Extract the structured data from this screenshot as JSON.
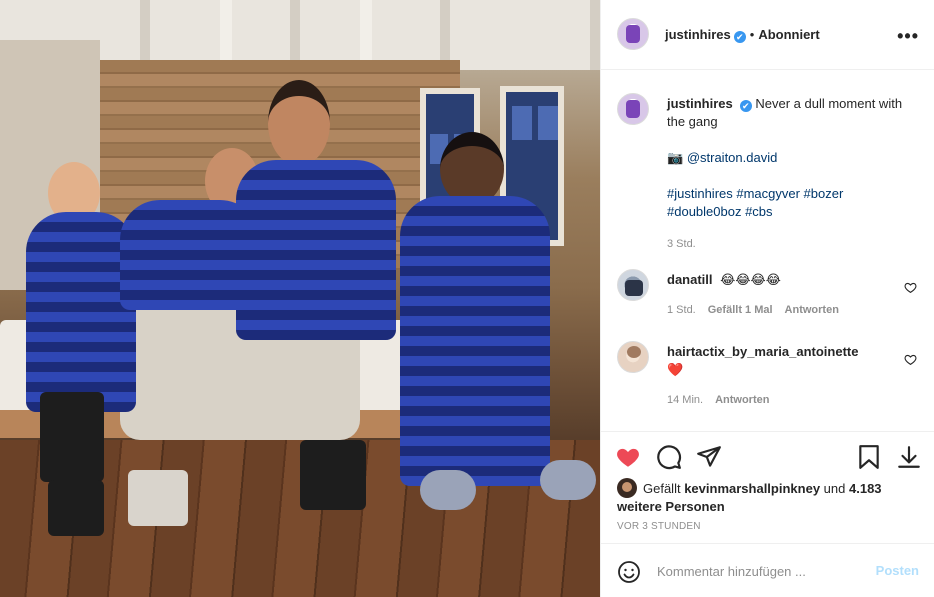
{
  "header": {
    "username": "justinhires",
    "verified_mark": "✔",
    "separator": "•",
    "follow_status": "Abonniert",
    "more_icon": "•••"
  },
  "caption": {
    "username": "justinhires",
    "text": "Never a dull moment with the gang",
    "camera_emoji": "📷",
    "credit": "@straiton.david",
    "hashtags_line1": "#justinhires #macgyver #bozer",
    "hashtags_line2": "#double0boz #cbs",
    "time": "3 Std."
  },
  "comments": [
    {
      "username": "danatill",
      "text": "😂😂😂😂",
      "time": "1 Std.",
      "likes": "Gefällt 1 Mal",
      "reply": "Antworten"
    },
    {
      "username": "hairtactix_by_maria_antoinette",
      "text": "❤️",
      "time": "14 Min.",
      "reply": "Antworten"
    }
  ],
  "likes": {
    "prefix": "Gefällt",
    "username": "kevinmarshallpinkney",
    "conjunction": "und",
    "others": "4.183 weitere Personen"
  },
  "timestamp": "VOR 3 STUNDEN",
  "composer": {
    "placeholder": "Kommentar hinzufügen ...",
    "post_label": "Posten"
  },
  "colors": {
    "like_red": "#ed4956",
    "link_blue": "#00376b",
    "verified_blue": "#3897f0",
    "post_button_disabled": "#b2dffc"
  },
  "icons": [
    "heart-icon",
    "comment-icon",
    "share-icon",
    "bookmark-icon",
    "download-icon",
    "emoji-icon",
    "more-icon"
  ]
}
